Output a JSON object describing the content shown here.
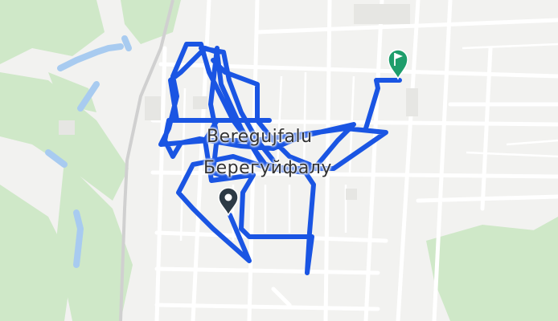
{
  "map": {
    "place_label_latin": "Beregujfalu",
    "place_label_cyrillic": "Берегуйфалу",
    "route_color": "#1a55e3",
    "start_marker_color": "#2d3a45",
    "end_marker_color": "#1e9d6b",
    "park_color": "#cfe8c8",
    "water_color": "#a8cbf0",
    "rail_color": "#cfcfcf"
  }
}
